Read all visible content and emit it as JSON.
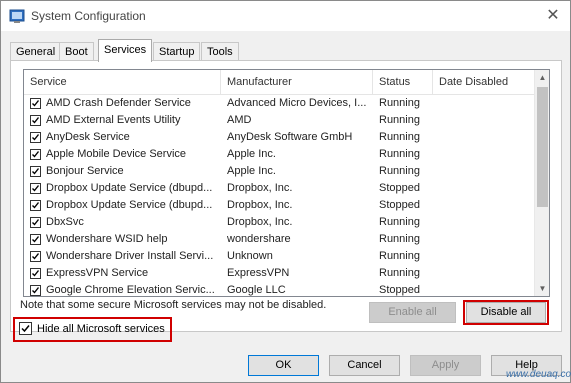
{
  "window": {
    "title": "System Configuration",
    "close_glyph": "✕"
  },
  "tabs": [
    "General",
    "Boot",
    "Services",
    "Startup",
    "Tools"
  ],
  "active_tab": "Services",
  "columns": [
    "Service",
    "Manufacturer",
    "Status",
    "Date Disabled"
  ],
  "services": [
    {
      "name": "AMD Crash Defender Service",
      "manufacturer": "Advanced Micro Devices, I...",
      "status": "Running",
      "checked": true
    },
    {
      "name": "AMD External Events Utility",
      "manufacturer": "AMD",
      "status": "Running",
      "checked": true
    },
    {
      "name": "AnyDesk Service",
      "manufacturer": "AnyDesk Software GmbH",
      "status": "Running",
      "checked": true
    },
    {
      "name": "Apple Mobile Device Service",
      "manufacturer": "Apple Inc.",
      "status": "Running",
      "checked": true
    },
    {
      "name": "Bonjour Service",
      "manufacturer": "Apple Inc.",
      "status": "Running",
      "checked": true
    },
    {
      "name": "Dropbox Update Service (dbupd...",
      "manufacturer": "Dropbox, Inc.",
      "status": "Stopped",
      "checked": true
    },
    {
      "name": "Dropbox Update Service (dbupd...",
      "manufacturer": "Dropbox, Inc.",
      "status": "Stopped",
      "checked": true
    },
    {
      "name": "DbxSvc",
      "manufacturer": "Dropbox, Inc.",
      "status": "Running",
      "checked": true
    },
    {
      "name": "Wondershare WSID help",
      "manufacturer": "wondershare",
      "status": "Running",
      "checked": true
    },
    {
      "name": "Wondershare Driver Install Servi...",
      "manufacturer": "Unknown",
      "status": "Running",
      "checked": true
    },
    {
      "name": "ExpressVPN Service",
      "manufacturer": "ExpressVPN",
      "status": "Running",
      "checked": true
    },
    {
      "name": "Google Chrome Elevation Servic...",
      "manufacturer": "Google LLC",
      "status": "Stopped",
      "checked": true
    }
  ],
  "note": "Note that some secure Microsoft services may not be disabled.",
  "buttons": {
    "enable_all": "Enable all",
    "disable_all": "Disable all",
    "ok": "OK",
    "cancel": "Cancel",
    "apply": "Apply",
    "help": "Help"
  },
  "hide_ms": {
    "label": "Hide all Microsoft services",
    "checked": true
  },
  "watermark": "www.deuaq.com",
  "colors": {
    "highlight": "#d00000",
    "window_bg": "#f0f0f0",
    "accent": "#0078d7"
  },
  "icons": {
    "app": "msconfig-icon",
    "scroll_up": "▲",
    "scroll_down": "▼"
  }
}
